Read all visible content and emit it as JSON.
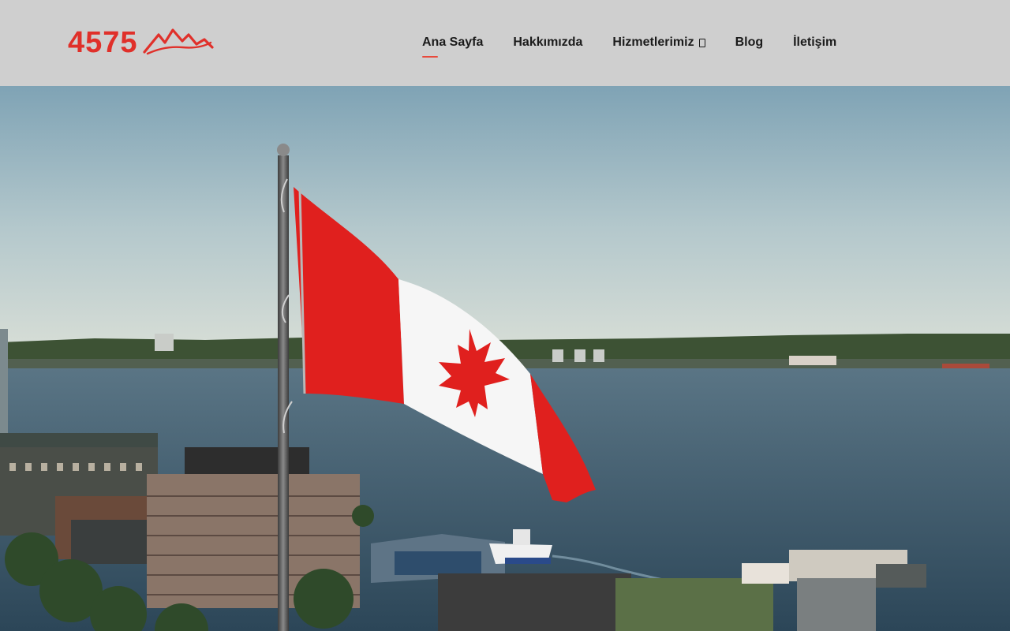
{
  "logo": {
    "text": "4575",
    "icon": "mountain-wave-icon",
    "color": "#e0302a"
  },
  "nav": {
    "items": [
      {
        "label": "Ana Sayfa",
        "active": true
      },
      {
        "label": "Hakkımızda"
      },
      {
        "label": "Hizmetlerimiz",
        "has_dropdown": true,
        "icon": "chevron-down-icon"
      },
      {
        "label": "Blog"
      },
      {
        "label": "İletişim"
      }
    ],
    "active_color": "#e84a3c"
  },
  "hero": {
    "image": "canadian-flag-over-harbor",
    "colors": {
      "sky_top": "#7a9db0",
      "sky_bottom": "#c8d6d6",
      "water": "#3a566a",
      "flag_red": "#e0201e"
    }
  }
}
